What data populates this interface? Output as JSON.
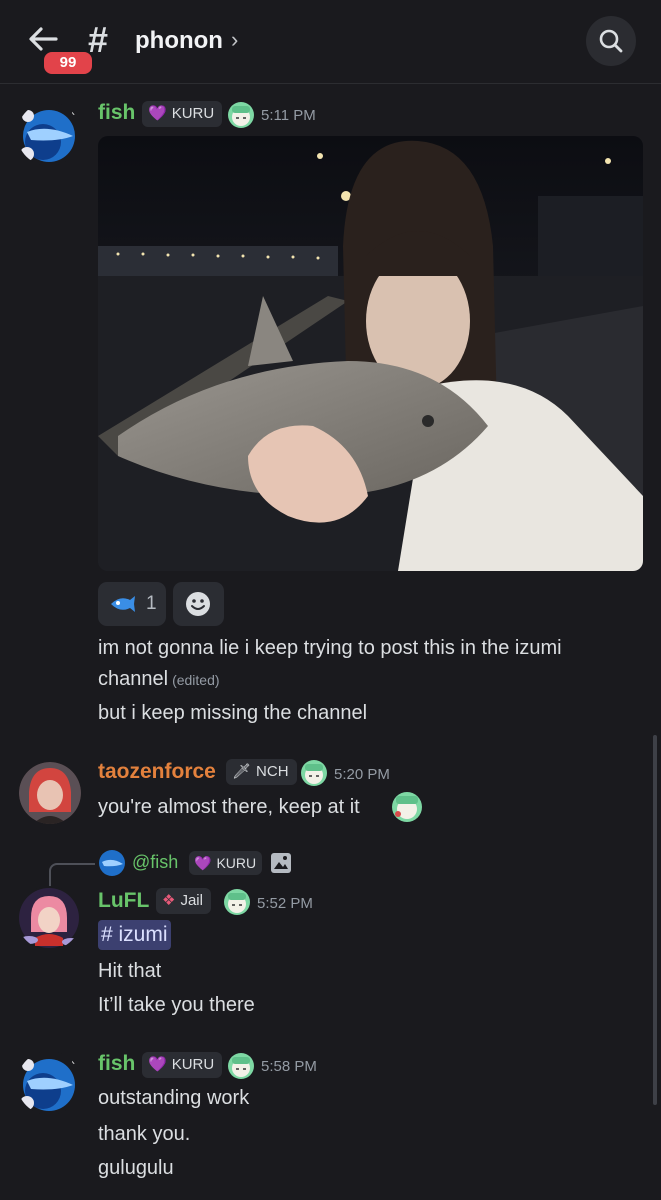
{
  "header": {
    "back_badge": "99",
    "channel_name": "phonon",
    "chevron": "›"
  },
  "messages": [
    {
      "author": "fish",
      "author_color": "#68c46a",
      "role": "KURU",
      "role_icon": "💜",
      "time": "5:11 PM",
      "reaction_count": "1",
      "lines": [
        "im not gonna lie i keep trying to post this in the izumi",
        "channel",
        "but i keep missing the channel"
      ],
      "edited": "(edited)"
    },
    {
      "author": "taozenforce",
      "author_color": "#e3813d",
      "role": "NCH",
      "role_icon": "🗡",
      "time": "5:20 PM",
      "lines": [
        "you're almost there, keep at it"
      ]
    },
    {
      "reply": {
        "author": "@fish",
        "role": "KURU",
        "role_icon": "💜"
      },
      "author": "LuFL",
      "author_color": "#68c46a",
      "role": "Jail",
      "role_icon": "❖",
      "time": "5:52 PM",
      "mention": "# izumi",
      "lines": [
        "Hit that",
        "It’ll take you there"
      ]
    },
    {
      "author": "fish",
      "author_color": "#68c46a",
      "role": "KURU",
      "role_icon": "💜",
      "time": "5:58 PM",
      "lines": [
        "outstanding work",
        "thank you.",
        "gulugulu"
      ]
    }
  ]
}
